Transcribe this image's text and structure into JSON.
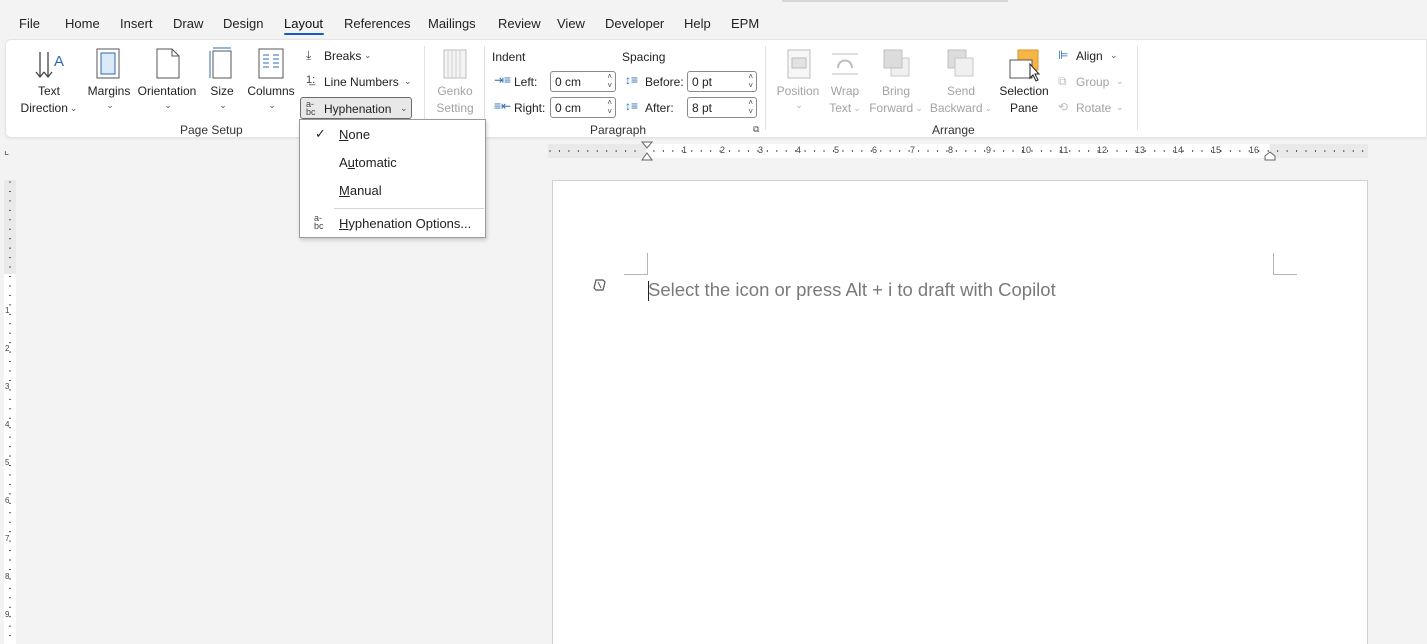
{
  "menu": {
    "tabs": [
      "File",
      "Home",
      "Insert",
      "Draw",
      "Design",
      "Layout",
      "References",
      "Mailings",
      "Review",
      "View",
      "Developer",
      "Help",
      "EPM"
    ],
    "active_tab": "Layout"
  },
  "page_setup": {
    "text_direction": [
      "Text",
      "Direction"
    ],
    "margins": "Margins",
    "orientation": "Orientation",
    "size": "Size",
    "columns": "Columns",
    "breaks": "Breaks",
    "line_numbers": "Line Numbers",
    "hyphenation": "Hyphenation",
    "group_label": "Page Setup"
  },
  "genko": [
    "Genko",
    "Setting"
  ],
  "paragraph": {
    "indent_label": "Indent",
    "spacing_label": "Spacing",
    "left_label": "Left:",
    "right_label": "Right:",
    "before_label": "Before:",
    "after_label": "After:",
    "left_value": "0 cm",
    "right_value": "0 cm",
    "before_value": "0 pt",
    "after_value": "8 pt",
    "group_label": "Paragraph"
  },
  "arrange": {
    "position": "Position",
    "wrap_text": [
      "Wrap",
      "Text"
    ],
    "bring_forward": [
      "Bring",
      "Forward"
    ],
    "send_backward": [
      "Send",
      "Backward"
    ],
    "selection_pane": [
      "Selection",
      "Pane"
    ],
    "align": "Align",
    "group": "Group",
    "rotate": "Rotate",
    "group_label": "Arrange"
  },
  "ruler": {
    "h_numbers": [
      "1",
      "2",
      "3",
      "4",
      "5",
      "6",
      "7",
      "8",
      "9",
      "10",
      "11",
      "12",
      "13",
      "14",
      "15",
      "16"
    ],
    "v_numbers": [
      "1",
      "1",
      "2",
      "3",
      "4",
      "5",
      "6",
      "7",
      "8",
      "9"
    ]
  },
  "hyphenation_menu": {
    "items": [
      {
        "label": "None",
        "checked": true
      },
      {
        "label": "Automatic",
        "checked": false
      },
      {
        "label": "Manual",
        "checked": false
      },
      {
        "label": "Hyphenation Options...",
        "checked": false
      }
    ]
  },
  "document": {
    "placeholder": "Select the icon or press Alt + i to draft with Copilot"
  },
  "colors": {
    "accent": "#185abd",
    "icon_blue": "#2b6cb0",
    "selection_orange": "#f5b547"
  },
  "icons": [
    "text-direction-icon",
    "margins-icon",
    "orientation-icon",
    "size-icon",
    "columns-icon",
    "breaks-icon",
    "line-numbers-icon",
    "hyphenation-icon",
    "genko-icon",
    "indent-left-icon",
    "indent-right-icon",
    "spacing-before-icon",
    "spacing-after-icon",
    "position-icon",
    "wrap-text-icon",
    "bring-forward-icon",
    "send-backward-icon",
    "selection-pane-icon",
    "align-icon",
    "group-icon",
    "rotate-icon",
    "copilot-icon",
    "check-icon",
    "dialog-launcher-icon"
  ]
}
